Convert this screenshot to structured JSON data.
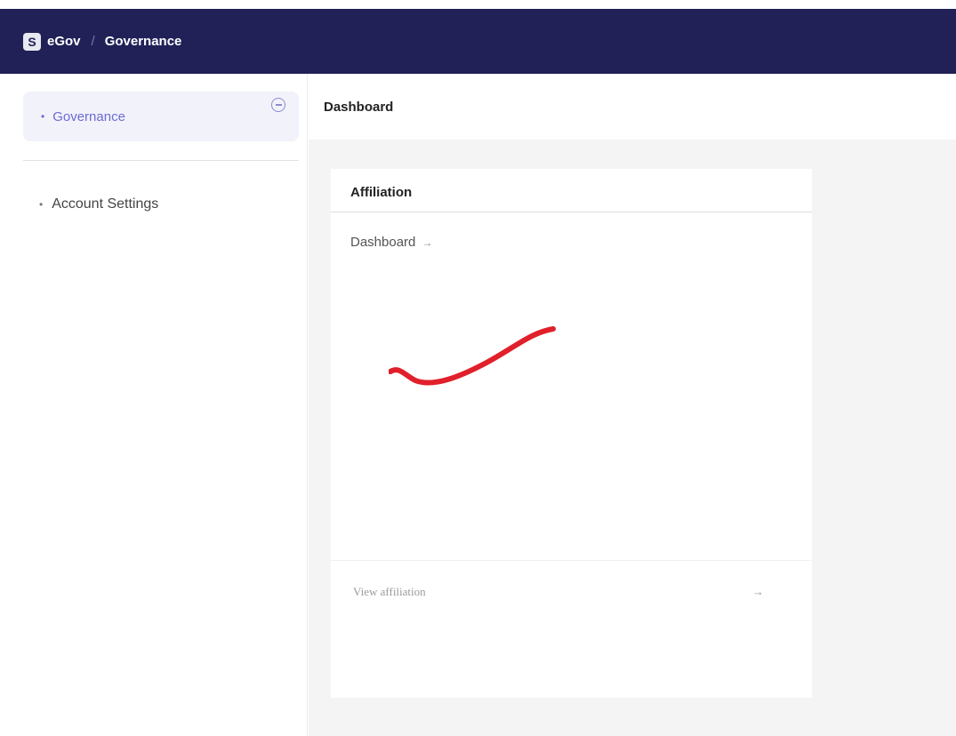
{
  "header": {
    "logo_letter": "S",
    "brand": "eGov",
    "separator": "/",
    "breadcrumb": "Governance"
  },
  "sidebar": {
    "items": [
      {
        "label": "Governance",
        "active": true
      },
      {
        "label": "Account Settings",
        "active": false
      }
    ],
    "bullet": "•",
    "collapse_icon": "collapse-circle-icon"
  },
  "main": {
    "page_title": "Dashboard",
    "card": {
      "title": "Affiliation",
      "link_label": "Dashboard",
      "link_arrow": "→",
      "footer_label": "View affiliation",
      "footer_arrow": "→"
    }
  },
  "annotation": {
    "type": "red-freehand-stroke",
    "color": "#e0202a"
  },
  "colors": {
    "topbar": "#212158",
    "active_nav_text": "#6b6bd6",
    "active_nav_bg": "#f2f2fa",
    "main_bg": "#f4f4f5"
  }
}
